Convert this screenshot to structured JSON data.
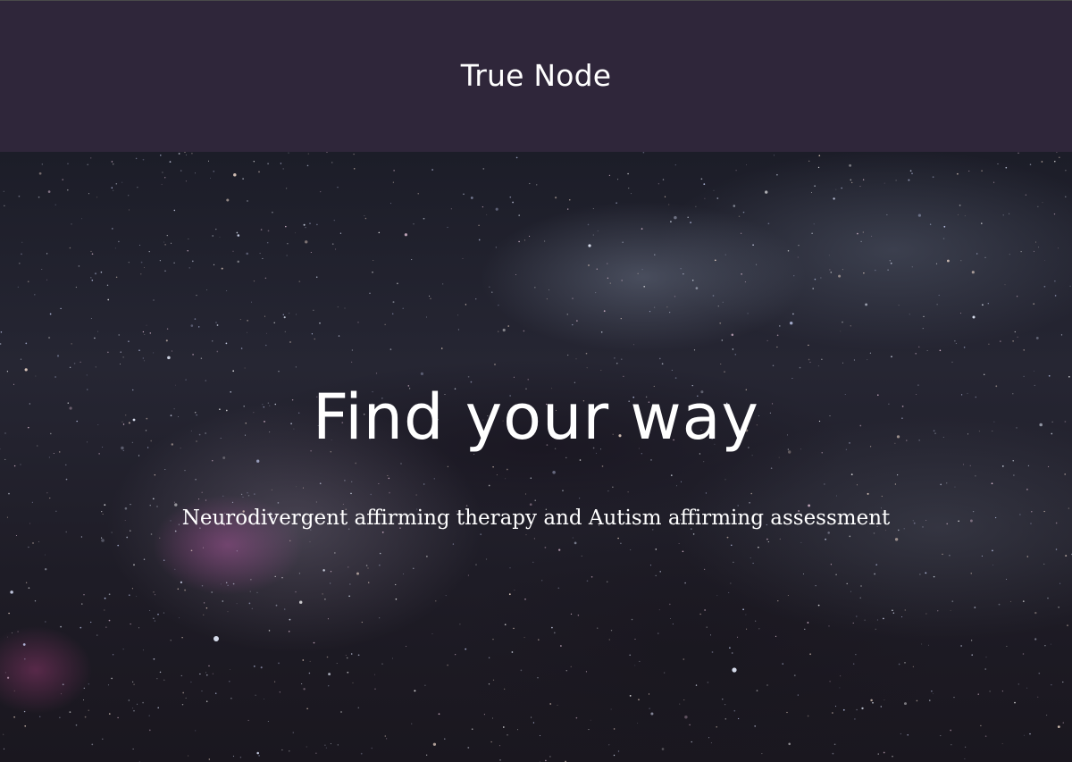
{
  "header": {
    "site_title": "True Node"
  },
  "hero": {
    "background_image": "milky-way-night-sky",
    "title": "Find your way",
    "subtitle": "Neurodivergent affirming therapy and Autism affirming assessment"
  },
  "colors": {
    "header_bg": "#2f263a",
    "text": "#ffffff"
  }
}
